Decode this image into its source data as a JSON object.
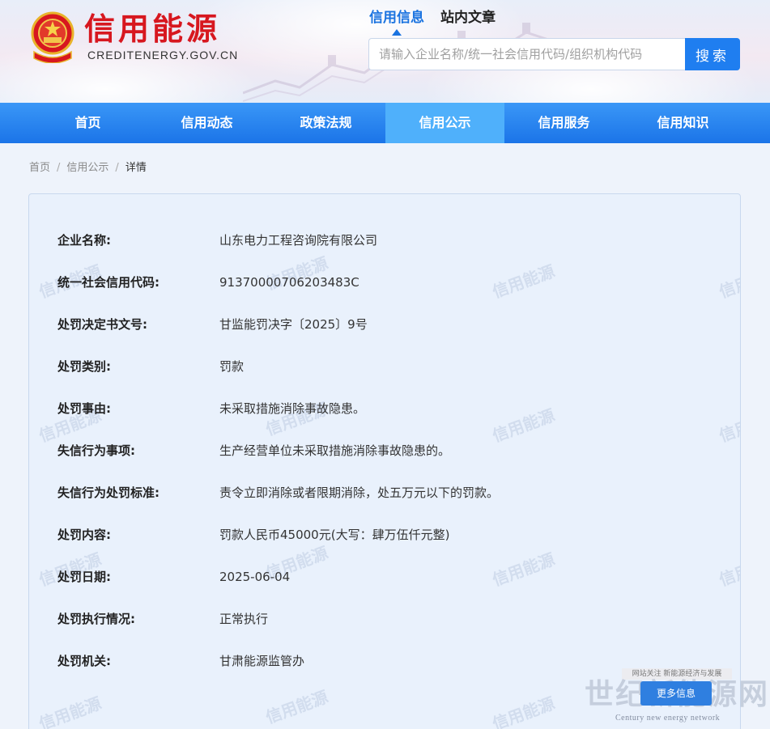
{
  "site": {
    "name": "信用能源",
    "domain": "CREDITENERGY.GOV.CN"
  },
  "top_tabs": [
    {
      "label": "信用信息",
      "active": true
    },
    {
      "label": "站内文章",
      "active": false
    }
  ],
  "search": {
    "placeholder": "请输入企业名称/统一社会信用代码/组织机构代码",
    "button_label": "搜索"
  },
  "nav": {
    "items": [
      {
        "label": "首页"
      },
      {
        "label": "信用动态"
      },
      {
        "label": "政策法规"
      },
      {
        "label": "信用公示",
        "active": true
      },
      {
        "label": "信用服务"
      },
      {
        "label": "信用知识"
      }
    ]
  },
  "breadcrumb": {
    "items": [
      "首页",
      "信用公示"
    ],
    "current": "详情",
    "separator": "/"
  },
  "watermark_text": "信用能源",
  "details": [
    {
      "label": "企业名称:",
      "value": "山东电力工程咨询院有限公司"
    },
    {
      "label": "统一社会信用代码:",
      "value": "91370000706203483C"
    },
    {
      "label": "处罚决定书文号:",
      "value": "甘监能罚决字〔2025〕9号"
    },
    {
      "label": "处罚类别:",
      "value": "罚款"
    },
    {
      "label": "处罚事由:",
      "value": "未采取措施消除事故隐患。"
    },
    {
      "label": "失信行为事项:",
      "value": "生产经营单位未采取措施消除事故隐患的。"
    },
    {
      "label": "失信行为处罚标准:",
      "value": "责令立即消除或者限期消除，处五万元以下的罚款。"
    },
    {
      "label": "处罚内容:",
      "value": "罚款人民币45000元(大写：肆万伍仟元整)"
    },
    {
      "label": "处罚日期:",
      "value": "2025-06-04"
    },
    {
      "label": "处罚执行情况:",
      "value": "正常执行"
    },
    {
      "label": "处罚机关:",
      "value": "甘肃能源监管办"
    }
  ],
  "corner": {
    "badge": "网站关注 新能源经济与发展",
    "button": "更多信息",
    "logo": "世纪新能源网",
    "sub": "Century new energy network"
  },
  "colors": {
    "brand_red": "#d7171f",
    "nav_blue": "#1b74e8",
    "nav_active": "#4fb0fb",
    "accent_blue": "#1a73e0"
  }
}
